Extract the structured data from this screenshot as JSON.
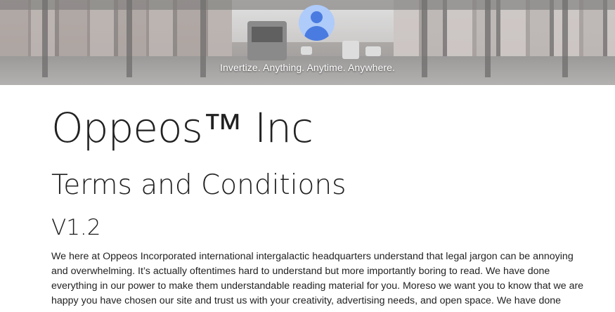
{
  "header": {
    "tagline": "Invertize. Anything. Anytime. Anywhere.",
    "banner_image": "city-street-elevated-train-banner",
    "avatar_icon": "account-circle-icon",
    "avatar_colors": {
      "background": "#aecbfa",
      "figure": "#4a7be0"
    }
  },
  "main": {
    "company_title": "Oppeos™ Inc",
    "page_title": "Terms and Conditions",
    "version": "V1.2",
    "intro_paragraph": "We here at Oppeos Incorporated international intergalactic headquarters understand that legal jargon can be annoying and overwhelming. It’s actually oftentimes hard to understand but more importantly boring to read. We have done everything in our power to make them understandable reading material for you. Moreso we want you to know that we are happy you have chosen our site and trust us with your creativity, advertising needs, and open space. We have done"
  }
}
